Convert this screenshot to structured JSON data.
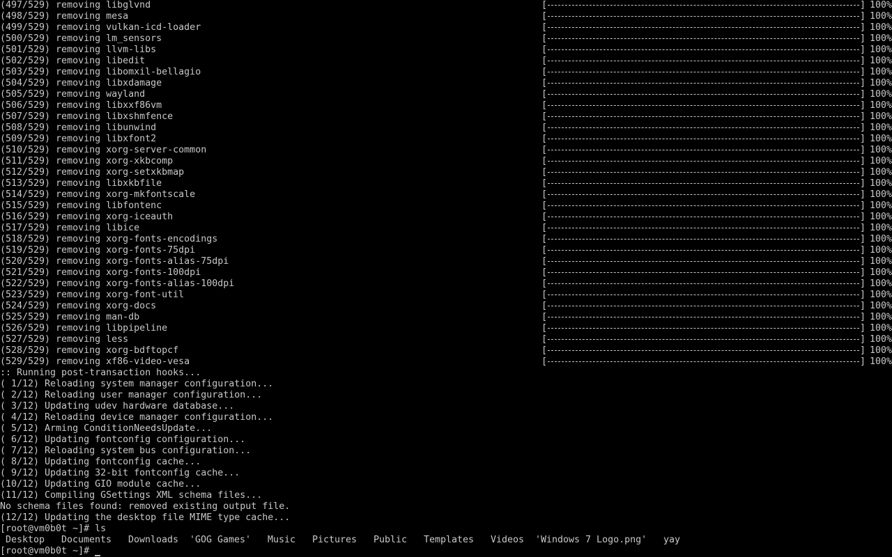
{
  "removals": [
    {
      "text": "(497/529) removing libglvnd",
      "percent": "100%",
      "progress": 100
    },
    {
      "text": "(498/529) removing mesa",
      "percent": "100%",
      "progress": 100
    },
    {
      "text": "(499/529) removing vulkan-icd-loader",
      "percent": "100%",
      "progress": 100
    },
    {
      "text": "(500/529) removing lm_sensors",
      "percent": "100%",
      "progress": 100
    },
    {
      "text": "(501/529) removing llvm-libs",
      "percent": "100%",
      "progress": 100
    },
    {
      "text": "(502/529) removing libedit",
      "percent": "100%",
      "progress": 100
    },
    {
      "text": "(503/529) removing libomxil-bellagio",
      "percent": "100%",
      "progress": 100
    },
    {
      "text": "(504/529) removing libxdamage",
      "percent": "100%",
      "progress": 100
    },
    {
      "text": "(505/529) removing wayland",
      "percent": "100%",
      "progress": 100
    },
    {
      "text": "(506/529) removing libxxf86vm",
      "percent": "100%",
      "progress": 100
    },
    {
      "text": "(507/529) removing libxshmfence",
      "percent": "100%",
      "progress": 100
    },
    {
      "text": "(508/529) removing libunwind",
      "percent": "100%",
      "progress": 100
    },
    {
      "text": "(509/529) removing libxfont2",
      "percent": "100%",
      "progress": 100
    },
    {
      "text": "(510/529) removing xorg-server-common",
      "percent": "100%",
      "progress": 100
    },
    {
      "text": "(511/529) removing xorg-xkbcomp",
      "percent": "100%",
      "progress": 100
    },
    {
      "text": "(512/529) removing xorg-setxkbmap",
      "percent": "100%",
      "progress": 100
    },
    {
      "text": "(513/529) removing libxkbfile",
      "percent": "100%",
      "progress": 100
    },
    {
      "text": "(514/529) removing xorg-mkfontscale",
      "percent": "100%",
      "progress": 100
    },
    {
      "text": "(515/529) removing libfontenc",
      "percent": "100%",
      "progress": 100
    },
    {
      "text": "(516/529) removing xorg-iceauth",
      "percent": "100%",
      "progress": 100
    },
    {
      "text": "(517/529) removing libice",
      "percent": "100%",
      "progress": 100
    },
    {
      "text": "(518/529) removing xorg-fonts-encodings",
      "percent": "100%",
      "progress": 100
    },
    {
      "text": "(519/529) removing xorg-fonts-75dpi",
      "percent": "100%",
      "progress": 100
    },
    {
      "text": "(520/529) removing xorg-fonts-alias-75dpi",
      "percent": "100%",
      "progress": 100
    },
    {
      "text": "(521/529) removing xorg-fonts-100dpi",
      "percent": "100%",
      "progress": 100
    },
    {
      "text": "(522/529) removing xorg-fonts-alias-100dpi",
      "percent": "100%",
      "progress": 100
    },
    {
      "text": "(523/529) removing xorg-font-util",
      "percent": "100%",
      "progress": 100
    },
    {
      "text": "(524/529) removing xorg-docs",
      "percent": "100%",
      "progress": 100
    },
    {
      "text": "(525/529) removing man-db",
      "percent": "100%",
      "progress": 100
    },
    {
      "text": "(526/529) removing libpipeline",
      "percent": "100%",
      "progress": 100
    },
    {
      "text": "(527/529) removing less",
      "percent": "100%",
      "progress": 100
    },
    {
      "text": "(528/529) removing xorg-bdftopcf",
      "percent": "100%",
      "progress": 100
    },
    {
      "text": "(529/529) removing xf86-video-vesa",
      "percent": "100%",
      "progress": 100
    }
  ],
  "bar_brackets": {
    "open": "[",
    "close": "]"
  },
  "hooks": [
    ":: Running post-transaction hooks...",
    "( 1/12) Reloading system manager configuration...",
    "( 2/12) Reloading user manager configuration...",
    "( 3/12) Updating udev hardware database...",
    "( 4/12) Reloading device manager configuration...",
    "( 5/12) Arming ConditionNeedsUpdate...",
    "( 6/12) Updating fontconfig configuration...",
    "( 7/12) Reloading system bus configuration...",
    "( 8/12) Updating fontconfig cache...",
    "( 9/12) Updating 32-bit fontconfig cache...",
    "(10/12) Updating GIO module cache...",
    "(11/12) Compiling GSettings XML schema files...",
    "No schema files found: removed existing output file.",
    "(12/12) Updating the desktop file MIME type cache..."
  ],
  "prompt_ls": "[root@vm0b0t ~]# ls",
  "ls_output": [
    "Desktop",
    "Documents",
    "Downloads",
    "'GOG Games'",
    "Music",
    "Pictures",
    "Public",
    "Templates",
    "Videos",
    "'Windows 7 Logo.png'",
    "yay"
  ],
  "prompt_current": "[root@vm0b0t ~]# ",
  "colors": {
    "background": "#000000",
    "foreground": "#c8c8c8"
  }
}
